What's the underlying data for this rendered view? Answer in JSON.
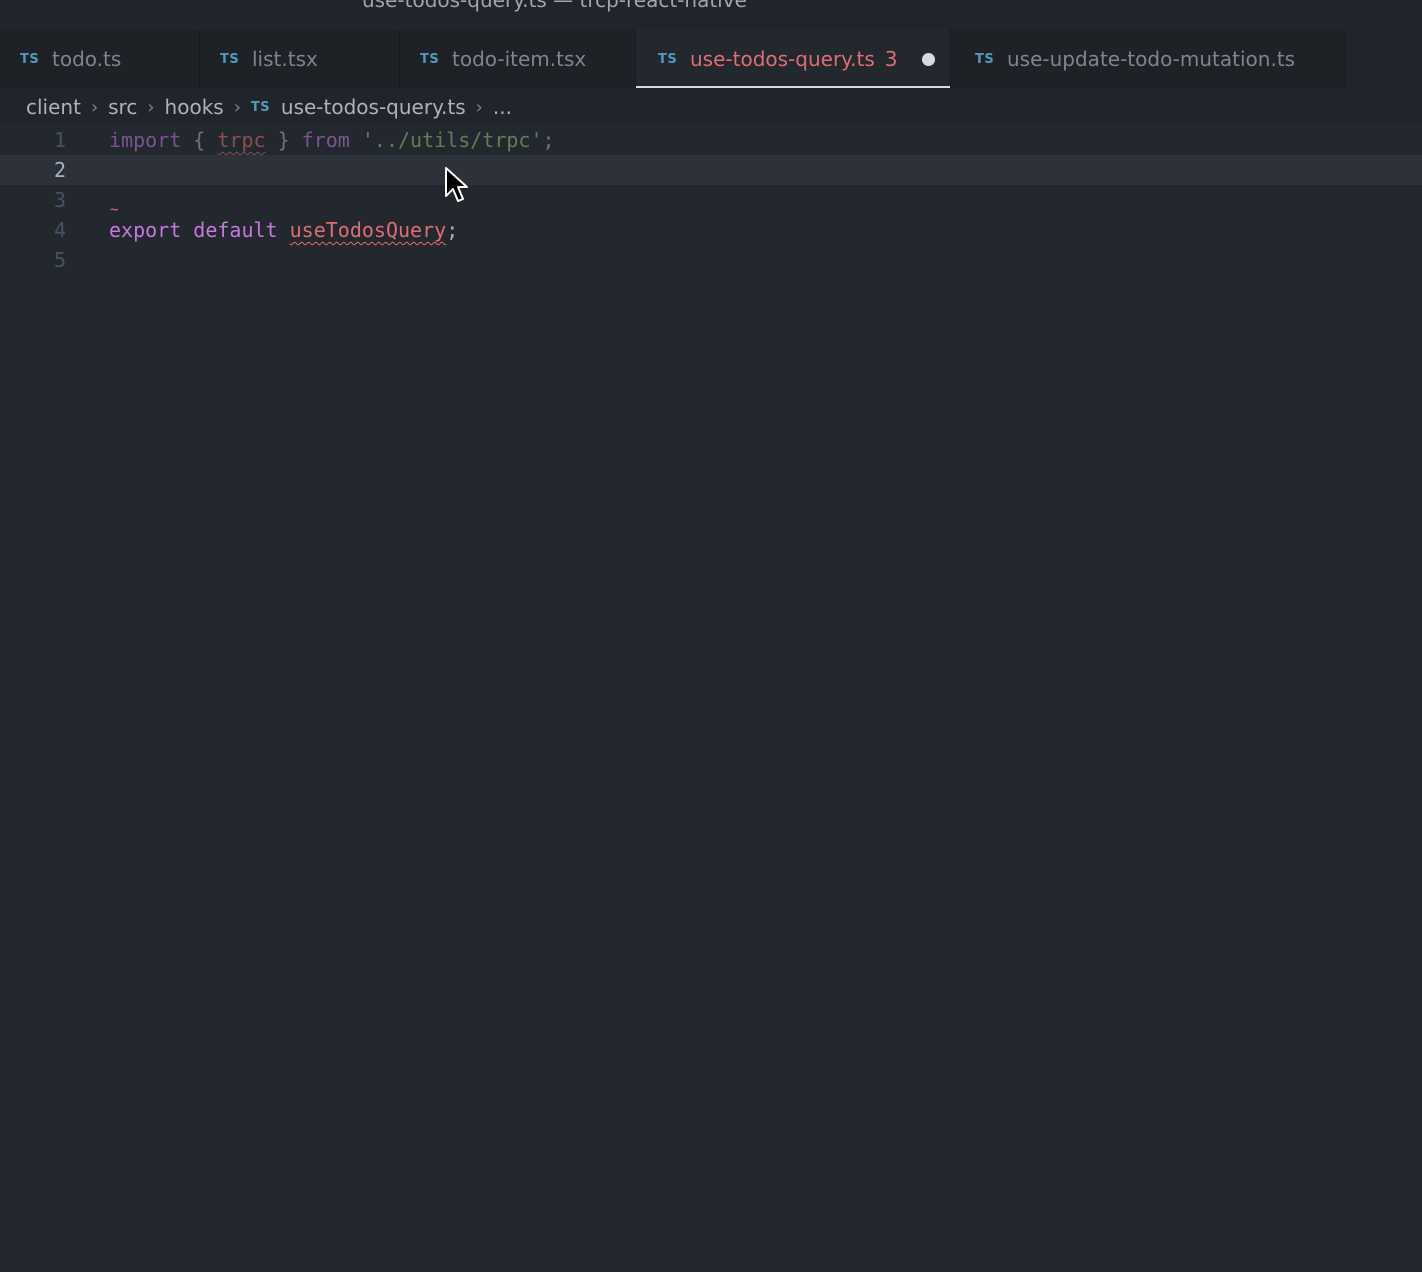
{
  "window": {
    "title": "use-todos-query.ts — trcp-react-native"
  },
  "tabs": [
    {
      "icon": "TS",
      "label": "todo.ts",
      "active": false
    },
    {
      "icon": "TS",
      "label": "list.tsx",
      "active": false
    },
    {
      "icon": "TS",
      "label": "todo-item.tsx",
      "active": false
    },
    {
      "icon": "TS",
      "label": "use-todos-query.ts",
      "active": true,
      "problems": "3",
      "dirty": true
    },
    {
      "icon": "TS",
      "label": "use-update-todo-mutation.ts",
      "active": false
    }
  ],
  "breadcrumb": {
    "items": [
      "client",
      "src",
      "hooks"
    ],
    "file_icon": "TS",
    "file": "use-todos-query.ts",
    "more": "..."
  },
  "editor": {
    "current_line": 2,
    "lines": [
      {
        "number": "1",
        "tokens": {
          "t1": "import",
          "t2": " { ",
          "t3": "trpc",
          "t4": " } ",
          "t5": "from",
          "t6": " ",
          "t7": "'../utils/trpc'",
          "t8": ";"
        }
      },
      {
        "number": "2"
      },
      {
        "number": "3",
        "error_marker": "~"
      },
      {
        "number": "4",
        "tokens": {
          "t1": "export",
          "t2": " ",
          "t3": "default",
          "t4": " ",
          "t5": "useTodosQuery",
          "t6": ";"
        }
      },
      {
        "number": "5"
      }
    ]
  },
  "colors": {
    "background": "#23272e",
    "keyword": "#c678dd",
    "identifier": "#e06c75",
    "string": "#98c379",
    "ts_icon": "#519aba",
    "error_tab": "#e06c75"
  },
  "icons": {
    "file_type": "typescript-icon",
    "dirty": "unsaved-dot-icon",
    "separator": "chevron-right-icon",
    "pointer": "mouse-pointer-icon"
  }
}
